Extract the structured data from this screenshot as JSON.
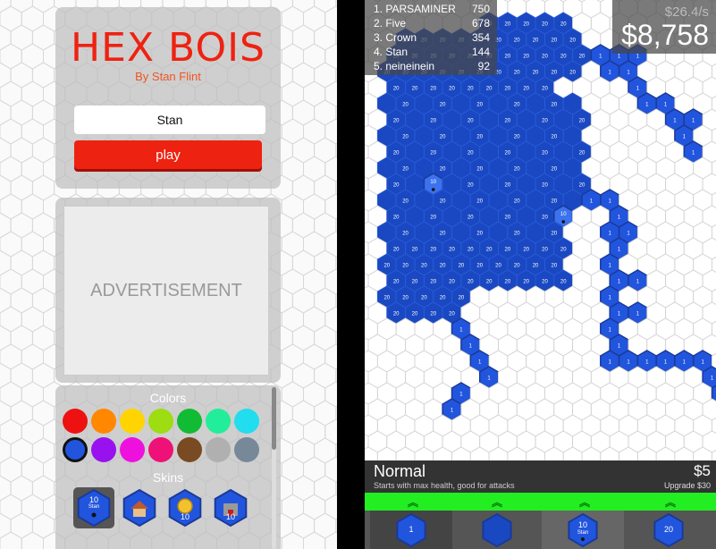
{
  "menu": {
    "title": "HEX BOIS",
    "byline": "By Stan Flint",
    "name_value": "Stan",
    "play_label": "play",
    "ad_label": "ADVERTISEMENT",
    "colors_label": "Colors",
    "skins_label": "Skins",
    "colors": [
      "#ee1111",
      "#ff8800",
      "#ffd400",
      "#9ddd11",
      "#11bb33",
      "#22ee99",
      "#22ddee",
      "#2255dd",
      "#9911ee",
      "#ee11dd",
      "#ee1177",
      "#7a4a22",
      "#b0b0b0",
      "#778899"
    ],
    "selected_color_index": 7,
    "skins": [
      {
        "label": "10",
        "sub": "Stan",
        "kind": "default"
      },
      {
        "label": "",
        "sub": "",
        "kind": "house"
      },
      {
        "label": "10",
        "sub": "",
        "kind": "coin"
      },
      {
        "label": "10",
        "sub": "",
        "kind": "castle"
      }
    ]
  },
  "game": {
    "leaderboard": [
      {
        "name": "1. PARSAMINER",
        "score": "750"
      },
      {
        "name": "2. Five",
        "score": "678"
      },
      {
        "name": "3. Crown",
        "score": "354"
      },
      {
        "name": "4. Stan",
        "score": "144"
      },
      {
        "name": "5. neineinein",
        "score": "92"
      }
    ],
    "rate": "$26.4/s",
    "money": "$8,758",
    "unit_name": "Normal",
    "unit_price": "$5",
    "unit_description": "Starts with max health, good for attacks",
    "upgrade_label": "Upgrade $30",
    "unit_options": [
      {
        "label": "1",
        "sub": ""
      },
      {
        "label": "",
        "sub": ""
      },
      {
        "label": "10",
        "sub": "Stan"
      },
      {
        "label": "20",
        "sub": ""
      }
    ],
    "map_labels": {
      "territory": "20",
      "trail": "1",
      "base": "10"
    },
    "colors": {
      "player": "#2255dd",
      "player_dark": "#1a48c2",
      "accent": "#ee2211",
      "upgrade_bar": "#22ee22"
    }
  }
}
